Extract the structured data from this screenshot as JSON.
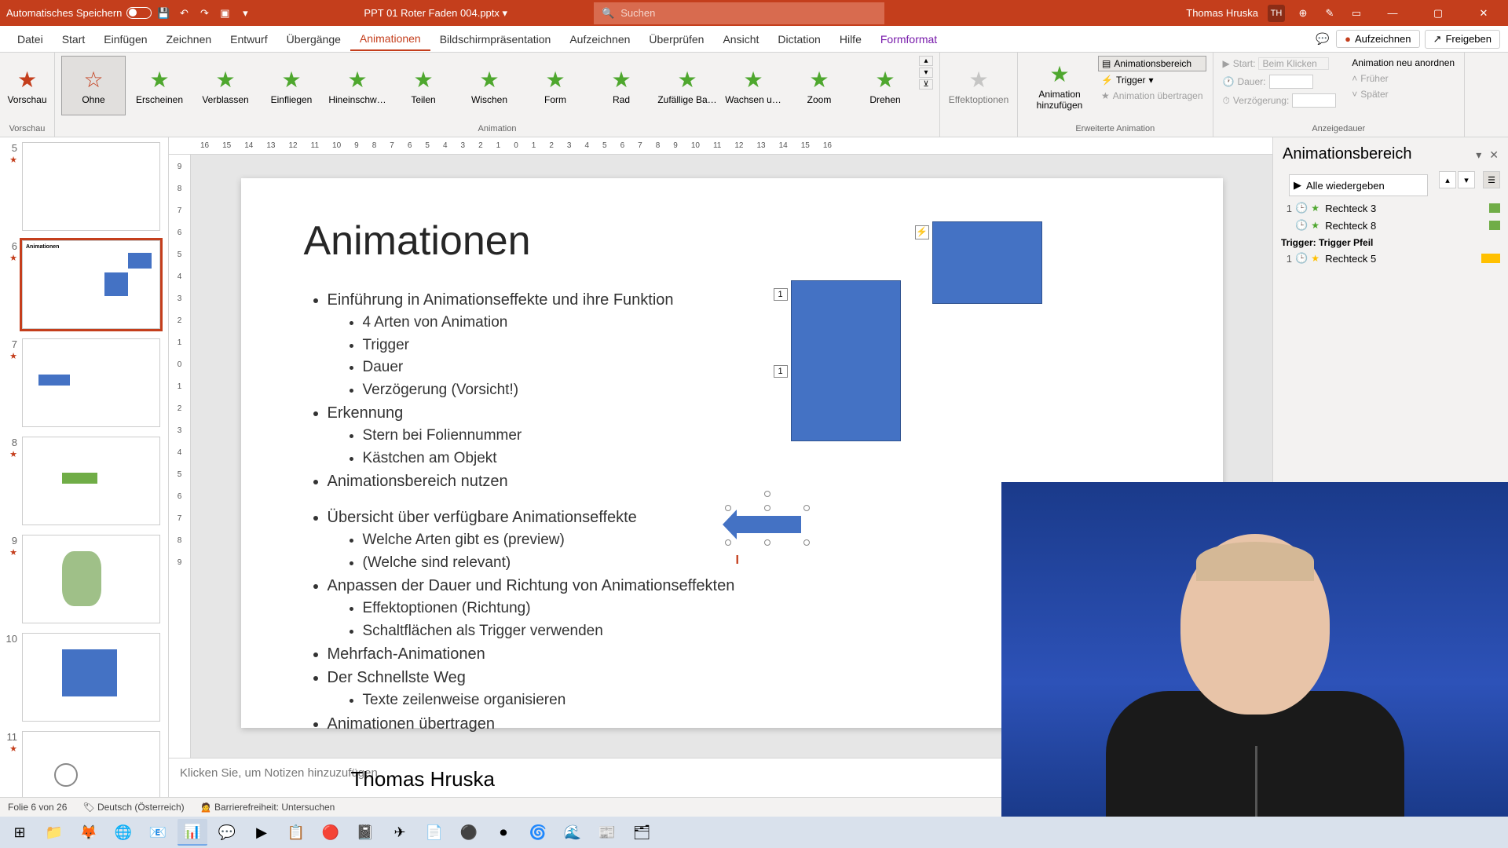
{
  "titlebar": {
    "autosave_label": "Automatisches Speichern",
    "filename": "PPT 01 Roter Faden 004.pptx",
    "search_placeholder": "Suchen",
    "user_name": "Thomas Hruska",
    "user_initials": "TH"
  },
  "menu": {
    "items": [
      "Datei",
      "Start",
      "Einfügen",
      "Zeichnen",
      "Entwurf",
      "Übergänge",
      "Animationen",
      "Bildschirmpräsentation",
      "Aufzeichnen",
      "Überprüfen",
      "Ansicht",
      "Dictation",
      "Hilfe",
      "Formformat"
    ],
    "active_index": 6,
    "record_btn": "Aufzeichnen",
    "share_btn": "Freigeben"
  },
  "ribbon": {
    "preview_label": "Vorschau",
    "preview_group": "Vorschau",
    "animations": [
      "Ohne",
      "Erscheinen",
      "Verblassen",
      "Einfliegen",
      "Hineinschw…",
      "Teilen",
      "Wischen",
      "Form",
      "Rad",
      "Zufällige Ba…",
      "Wachsen u…",
      "Zoom",
      "Drehen"
    ],
    "animation_group": "Animation",
    "effect_options": "Effektoptionen",
    "add_anim": "Animation hinzufügen",
    "anim_pane": "Animationsbereich",
    "trigger": "Trigger",
    "anim_painter": "Animation übertragen",
    "ext_anim_group": "Erweiterte Animation",
    "start_label": "Start:",
    "start_value": "Beim Klicken",
    "duration_label": "Dauer:",
    "delay_label": "Verzögerung:",
    "reorder_label": "Animation neu anordnen",
    "earlier": "Früher",
    "later": "Später",
    "timing_group": "Anzeigedauer"
  },
  "ruler_marks_h": [
    "16",
    "15",
    "14",
    "13",
    "12",
    "11",
    "10",
    "9",
    "8",
    "7",
    "6",
    "5",
    "4",
    "3",
    "2",
    "1",
    "0",
    "1",
    "2",
    "3",
    "4",
    "5",
    "6",
    "7",
    "8",
    "9",
    "10",
    "11",
    "12",
    "13",
    "14",
    "15",
    "16"
  ],
  "ruler_marks_v": [
    "9",
    "8",
    "7",
    "6",
    "5",
    "4",
    "3",
    "2",
    "1",
    "0",
    "1",
    "2",
    "3",
    "4",
    "5",
    "6",
    "7",
    "8",
    "9"
  ],
  "thumbnails": {
    "visible": [
      5,
      6,
      7,
      8,
      9,
      10,
      11
    ],
    "active": 6
  },
  "slide": {
    "title": "Animationen",
    "bullets_l1": {
      "b1": "Einführung in Animationseffekte und ihre Funktion",
      "b1_subs": [
        "4 Arten von Animation",
        "Trigger",
        "Dauer",
        "Verzögerung (Vorsicht!)"
      ],
      "b2": "Erkennung",
      "b2_subs": [
        "Stern bei Foliennummer",
        "Kästchen am Objekt"
      ],
      "b3": "Animationsbereich nutzen",
      "b4": "Übersicht über verfügbare Animationseffekte",
      "b4_subs": [
        "Welche Arten gibt es (preview)",
        "(Welche sind relevant)"
      ],
      "b5": "Anpassen der Dauer und Richtung von Animationseffekten",
      "b5_subs": [
        "Effektoptionen (Richtung)",
        "Schaltflächen als Trigger verwenden"
      ],
      "b6": "Mehrfach-Animationen",
      "b7": "Der Schnellste Weg",
      "b7_subs": [
        "Texte zeilenweise organisieren"
      ],
      "b8": "Animationen übertragen"
    },
    "author": "Thomas Hruska",
    "tag1": "1",
    "tag2": "1",
    "lightning": "⚡"
  },
  "notes_placeholder": "Klicken Sie, um Notizen hinzuzufügen",
  "anim_panel": {
    "title": "Animationsbereich",
    "play_all": "Alle wiedergeben",
    "items": [
      {
        "num": "1",
        "clock": "🕒",
        "name": "Rechteck 3",
        "color": "#70ad47"
      },
      {
        "num": "",
        "clock": "🕒",
        "name": "Rechteck 8",
        "color": "#70ad47"
      }
    ],
    "trigger_label": "Trigger: Trigger Pfeil",
    "trigger_items": [
      {
        "num": "1",
        "clock": "🕒",
        "name": "Rechteck 5",
        "color": "#ffc000"
      }
    ]
  },
  "statusbar": {
    "slide_count": "Folie 6 von 26",
    "language": "Deutsch (Österreich)",
    "accessibility": "Barrierefreiheit: Untersuchen"
  }
}
